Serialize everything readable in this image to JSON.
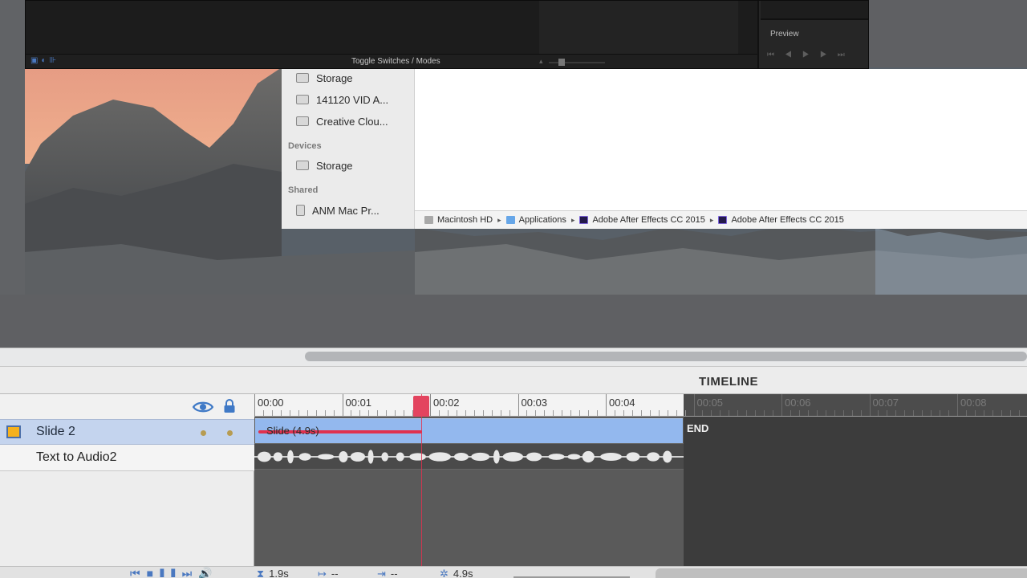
{
  "after_effects": {
    "toggle_label": "Toggle Switches / Modes",
    "preview_label": "Preview"
  },
  "finder": {
    "favorites": [
      "Storage",
      "141120 VID A...",
      "Creative Clou..."
    ],
    "devices_heading": "Devices",
    "devices": [
      "Storage"
    ],
    "shared_heading": "Shared",
    "shared": [
      "ANM Mac Pr..."
    ],
    "path": [
      "Macintosh HD",
      "Applications",
      "Adobe After Effects CC 2015",
      "Adobe After Effects CC 2015"
    ]
  },
  "timeline": {
    "title": "TIMELINE",
    "ruler": [
      "00:00",
      "00:01",
      "00:02",
      "00:03",
      "00:04",
      "00:05",
      "00:06",
      "00:07",
      "00:08"
    ],
    "duration_seconds": 4.9,
    "playhead_seconds": 1.9,
    "layers": [
      {
        "name": "Slide 2",
        "type": "slide",
        "selected": true
      },
      {
        "name": "Text to Audio2",
        "type": "audio",
        "selected": false
      }
    ],
    "slide_bar_label": "Slide (4.9s)",
    "end_label": "END",
    "bottom": {
      "playhead_readout": "1.9s",
      "in_readout": "--",
      "out_readout": "--",
      "duration_readout": "4.9s"
    }
  },
  "colors": {
    "playhead": "#e3445f",
    "slide_bar": "#93b8ee",
    "selected_row": "#c4d4ee",
    "slide_icon": "#f5b11e",
    "accent": "#4a78c0"
  }
}
